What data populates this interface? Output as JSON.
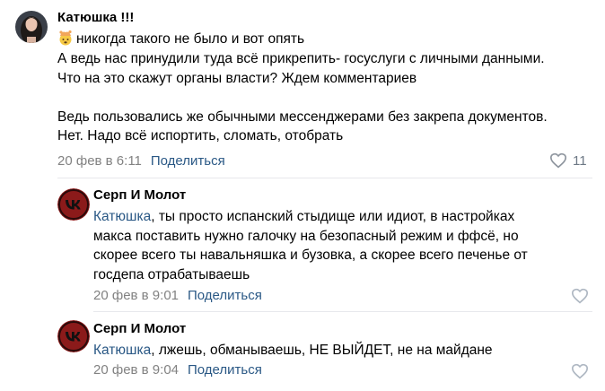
{
  "comment": {
    "author": "Катюшка !!!",
    "text_line1": "никогда такого не было и вот опять",
    "text_rest": "А ведь нас принудили туда всё прикрепить- госуслуги с личными данными.\nЧто на это скажут органы власти? Ждем комментариев\n\nВедь пользовались же обычными мессенджерами без закрепа документов.\nНет. Надо всё испортить, сломать, отобрать",
    "date": "20 фев в 6:11",
    "share_label": "Поделиться",
    "likes": "11"
  },
  "replies": [
    {
      "author": "Серп И Молот",
      "mention": "Катюшка",
      "text": ", ты просто испанский стыдище или идиот, в настройках\nмакса поставить нужно галочку на безопасный режим и ффсё, но\nскорее всего ты навальняшка и бузовка, а скорее всего печенье от\nгосдепа отрабатываешь",
      "date": "20 фев в 9:01",
      "share_label": "Поделиться"
    },
    {
      "author": "Серп И Молот",
      "mention": "Катюшка",
      "text": ", лжешь, обманываешь, НЕ ВЫЙДЕТ, не на майдане",
      "date": "20 фев в 9:04",
      "share_label": "Поделиться"
    }
  ],
  "icons": [
    "exploding-head-emoji",
    "heart-icon",
    "vk-logo-icon"
  ],
  "colors": {
    "link": "#2a5885",
    "meta": "#828282",
    "vk_avatar_bg": "#8b1a1a"
  }
}
